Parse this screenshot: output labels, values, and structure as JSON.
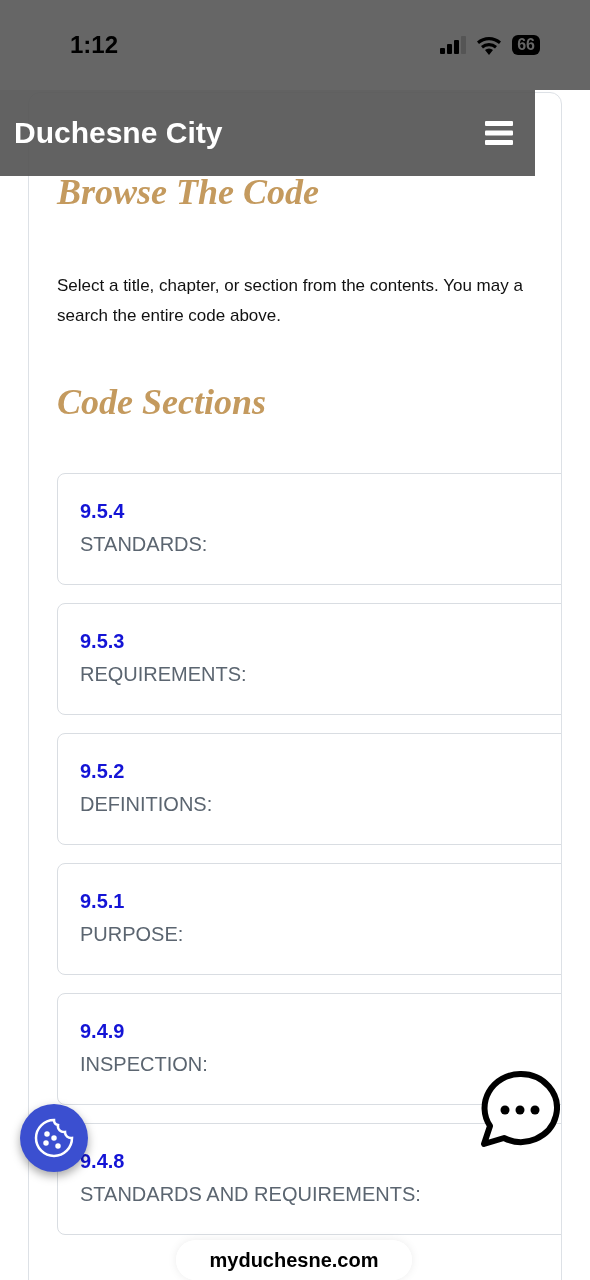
{
  "status_bar": {
    "time": "1:12",
    "battery": "66"
  },
  "header": {
    "title": "Duchesne City"
  },
  "browse": {
    "heading": "Browse The Code",
    "intro_lines": [
      "Select a title, chapter, or section from the contents. You may a",
      "search the entire code above."
    ]
  },
  "sections": {
    "heading": "Code Sections",
    "items": [
      {
        "number": "9.5.4",
        "title": "STANDARDS:"
      },
      {
        "number": "9.5.3",
        "title": "REQUIREMENTS:"
      },
      {
        "number": "9.5.2",
        "title": "DEFINITIONS:"
      },
      {
        "number": "9.5.1",
        "title": "PURPOSE:"
      },
      {
        "number": "9.4.9",
        "title": "INSPECTION:"
      },
      {
        "number": "9.4.8",
        "title": "STANDARDS AND REQUIREMENTS:"
      }
    ]
  },
  "browser": {
    "url": "myduchesne.com"
  }
}
